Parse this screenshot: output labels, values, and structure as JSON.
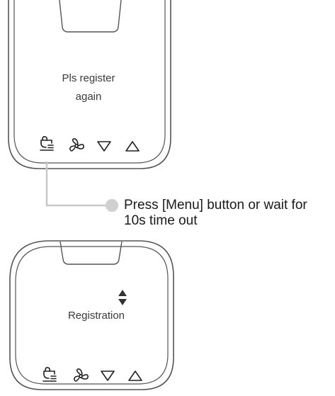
{
  "panel_top": {
    "message_line1": "Pls register",
    "message_line2": "again",
    "buttons": [
      "menu-icon",
      "fan-icon",
      "down-arrow-icon",
      "up-arrow-icon"
    ]
  },
  "callout": {
    "line1": "Press [Menu] button or wait for",
    "line2": "10s time out"
  },
  "panel_bottom": {
    "message": "Registration",
    "indicator": "up-down-arrows-icon",
    "buttons": [
      "menu-icon",
      "fan-icon",
      "down-arrow-icon",
      "up-arrow-icon"
    ]
  },
  "colors": {
    "outline": "#555555",
    "connector": "#c8c8c8",
    "dot": "#d0d0d0",
    "text": "#1a1a1a"
  }
}
